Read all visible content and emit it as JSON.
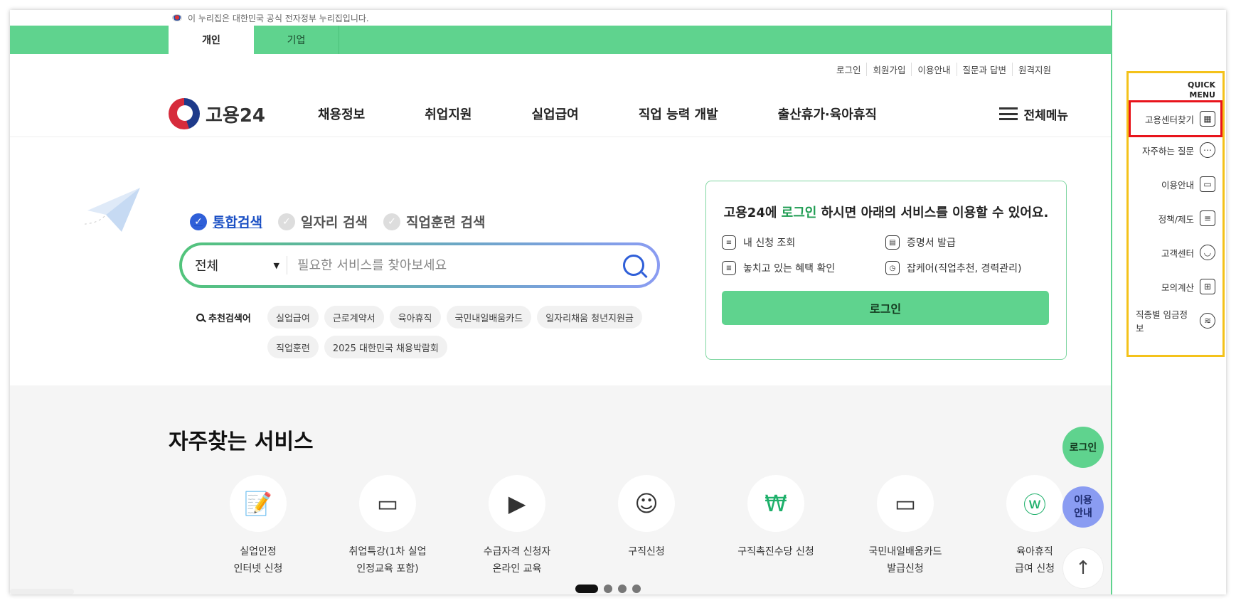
{
  "gov_banner": {
    "text": "이 누리집은 대한민국 공식 전자정부 누리집입니다."
  },
  "user_tabs": [
    {
      "label": "개인",
      "active": true
    },
    {
      "label": "기업",
      "active": false
    }
  ],
  "utility_links": [
    "로그인",
    "회원가입",
    "이용안내",
    "질문과 답변",
    "원격지원"
  ],
  "logo": {
    "text": "고용24"
  },
  "gnb": [
    "채용정보",
    "취업지원",
    "실업급여",
    "직업 능력 개발",
    "출산휴가·육아휴직"
  ],
  "all_menu_label": "전체메뉴",
  "search": {
    "tabs": [
      {
        "label": "통합검색",
        "active": true
      },
      {
        "label": "일자리 검색",
        "active": false
      },
      {
        "label": "직업훈련 검색",
        "active": false
      }
    ],
    "category": "전체",
    "placeholder": "필요한 서비스를 찾아보세요",
    "value": ""
  },
  "recommended": {
    "label": "추천검색어",
    "keywords": [
      "실업급여",
      "근로계약서",
      "육아휴직",
      "국민내일배움카드",
      "일자리채움 청년지원금",
      "직업훈련",
      "2025 대한민국 채용박람회"
    ]
  },
  "login_card": {
    "title_prefix": "고용24에 ",
    "title_highlight": "로그인",
    "title_suffix": " 하시면 아래의 서비스를 이용할 수 있어요.",
    "services": [
      "내 신청 조회",
      "증명서 발급",
      "놓치고 있는 혜택 확인",
      "잡케어(직업추천, 경력관리)"
    ],
    "button_label": "로그인"
  },
  "frequent": {
    "title": "자주찾는 서비스",
    "items": [
      {
        "name": "실업인정\n인터넷 신청",
        "icon": "document-pen-icon"
      },
      {
        "name": "취업특강(1차 실업\n인정교육 포함)",
        "icon": "presentation-board-icon"
      },
      {
        "name": "수급자격 신청자\n온라인 교육",
        "icon": "monitor-play-icon"
      },
      {
        "name": "구직신청",
        "icon": "person-pen-icon"
      },
      {
        "name": "구직촉진수당 신청",
        "icon": "money-bag-icon"
      },
      {
        "name": "국민내일배움카드\n발급신청",
        "icon": "credit-card-icon"
      },
      {
        "name": "육아휴직\n급여 신청",
        "icon": "baby-bottle-icon"
      }
    ],
    "pagination": {
      "current": 1,
      "total": 4
    }
  },
  "floating": {
    "login": "로그인",
    "guide": "이용\n안내",
    "top": "↑"
  },
  "quick_menu": {
    "title": "QUICK\nMENU",
    "items": [
      {
        "label": "고용센터찾기",
        "icon": "building-icon",
        "highlighted": true
      },
      {
        "label": "자주하는 질문",
        "icon": "chat-bubble-icon",
        "highlighted": false
      },
      {
        "label": "이용안내",
        "icon": "monitor-icon",
        "highlighted": false
      },
      {
        "label": "정책/제도",
        "icon": "checklist-icon",
        "highlighted": false
      },
      {
        "label": "고객센터",
        "icon": "smile-icon",
        "highlighted": false
      },
      {
        "label": "모의계산",
        "icon": "calculator-icon",
        "highlighted": false
      },
      {
        "label": "직종별 임금정보",
        "icon": "coin-stack-icon",
        "highlighted": false
      }
    ]
  },
  "colors": {
    "brand_green": "#5fd38e",
    "accent_blue": "#2f5fd8",
    "highlight_yellow": "#f4c21a",
    "highlight_red": "#e8141c"
  }
}
